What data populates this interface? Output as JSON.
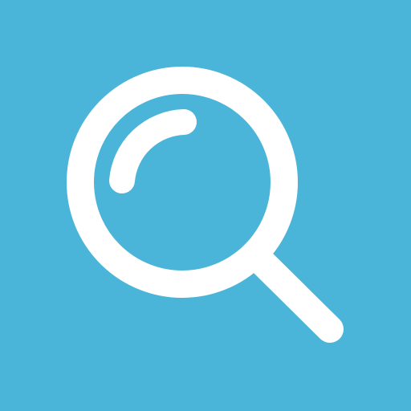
{
  "icon": {
    "name": "search-icon",
    "background_color": "#4AB5D8",
    "foreground_color": "#FFFFFF"
  }
}
